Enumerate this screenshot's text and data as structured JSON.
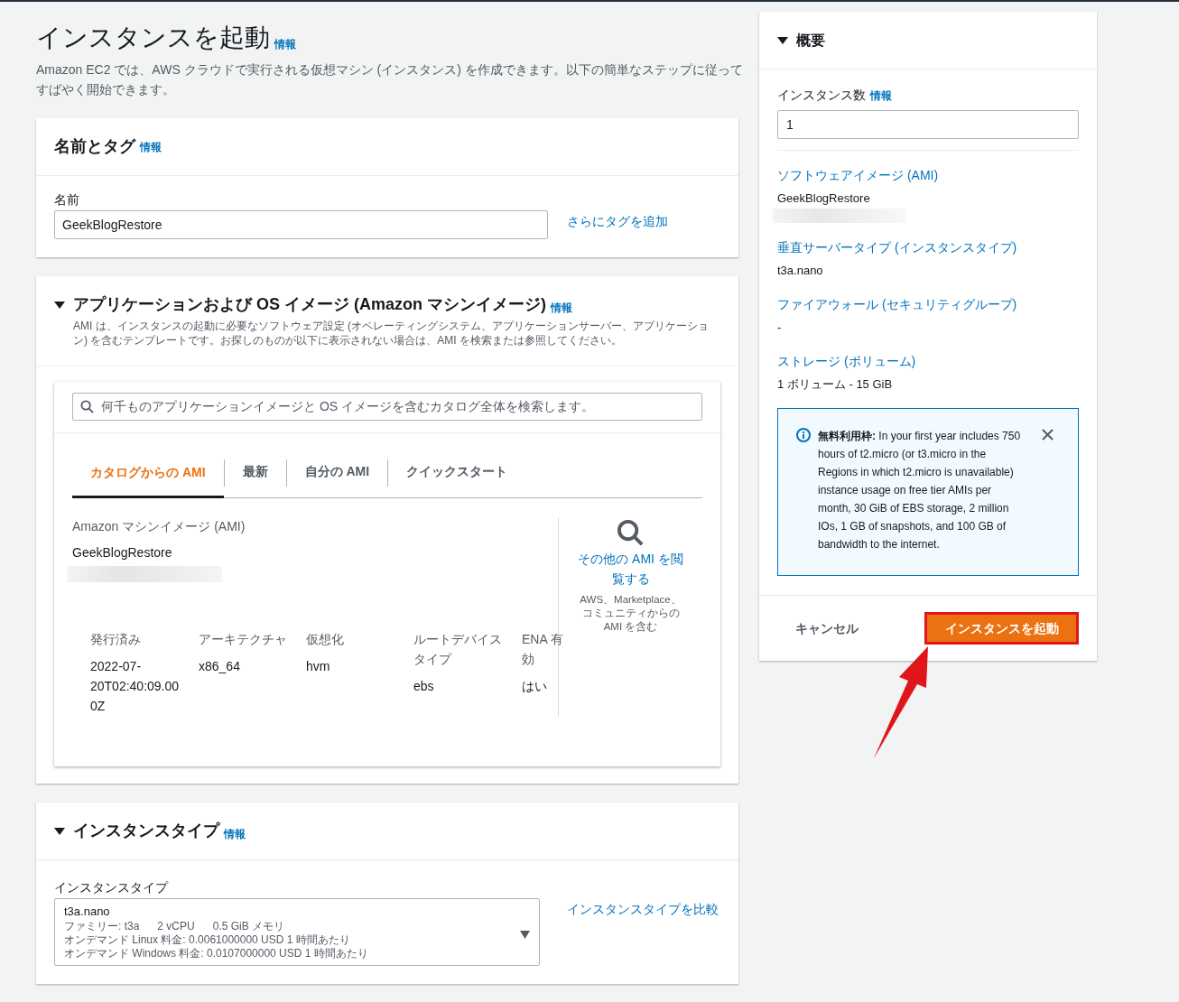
{
  "page": {
    "title": "インスタンスを起動",
    "info": "情報",
    "description": "Amazon EC2 では、AWS クラウドで実行される仮想マシン (インスタンス) を作成できます。以下の簡単なステップに従ってすばやく開始できます。"
  },
  "name_tags": {
    "title": "名前とタグ",
    "info": "情報",
    "name_label": "名前",
    "name_value": "GeekBlogRestore",
    "add_tags_link": "さらにタグを追加"
  },
  "ami_section": {
    "title": "アプリケーションおよび OS イメージ (Amazon マシンイメージ)",
    "info": "情報",
    "expanded": true,
    "description": "AMI は、インスタンスの起動に必要なソフトウェア設定 (オペレーティングシステム、アプリケーションサーバー、アプリケーション) を含むテンプレートです。お探しのものが以下に表示されない場合は、AMI を検索または参照してください。",
    "search": {
      "placeholder": "何千ものアプリケーションイメージと OS イメージを含むカタログ全体を検索します。"
    },
    "tabs": [
      {
        "label": "カタログからの AMI",
        "selected": true
      },
      {
        "label": "最新",
        "selected": false
      },
      {
        "label": "自分の AMI",
        "selected": false
      },
      {
        "label": "クイックスタート",
        "selected": false
      }
    ],
    "ami_label": "Amazon マシンイメージ (AMI)",
    "ami_name": "GeekBlogRestore",
    "details": [
      {
        "label": "発行済み",
        "value": "2022-07-20T02:40:09.000Z"
      },
      {
        "label": "アーキテクチャ",
        "value": "x86_64"
      },
      {
        "label": "仮想化",
        "value": "hvm"
      },
      {
        "label": "ルートデバイスタイプ",
        "value": "ebs"
      },
      {
        "label": "ENA 有効",
        "value": "はい"
      }
    ],
    "browse_link": "その他の AMI を閲覧する",
    "browse_note": "AWS、Marketplace、コミュニティからの AMI を含む"
  },
  "instance_type_section": {
    "title": "インスタンスタイプ",
    "info": "情報",
    "expanded": true,
    "field_label": "インスタンスタイプ",
    "selected_type": "t3a.nano",
    "family": "ファミリー: t3a",
    "vcpu": "2 vCPU",
    "memory": "0.5 GiB メモリ",
    "linux_price": "オンデマンド Linux 料金: 0.0061000000 USD 1 時間あたり",
    "windows_price": "オンデマンド Windows 料金: 0.0107000000 USD 1 時間あたり",
    "compare_link": "インスタンスタイプを比較"
  },
  "summary": {
    "title": "概要",
    "expanded": true,
    "count_label": "インスタンス数",
    "count_info": "情報",
    "count_value": "1",
    "items": [
      {
        "label": "ソフトウェアイメージ (AMI)",
        "value": "GeekBlogRestore"
      },
      {
        "label": "垂直サーバータイプ (インスタンスタイプ)",
        "value": "t3a.nano"
      },
      {
        "label": "ファイアウォール (セキュリティグループ)",
        "value": "-"
      },
      {
        "label": "ストレージ (ボリューム)",
        "value": "1 ボリューム - 15 GiB"
      }
    ],
    "free_tier": {
      "text": "**無料利用枠:** In your first year includes 750 hours of t2.micro (or t3.micro in the Regions in which t2.micro is unavailable) instance usage on free tier AMIs per month, 30 GiB of EBS storage, 2 million IOs, 1 GB of snapshots, and 100 GB of bandwidth to the internet."
    },
    "cancel": "キャンセル",
    "launch": "インスタンスを起動"
  }
}
